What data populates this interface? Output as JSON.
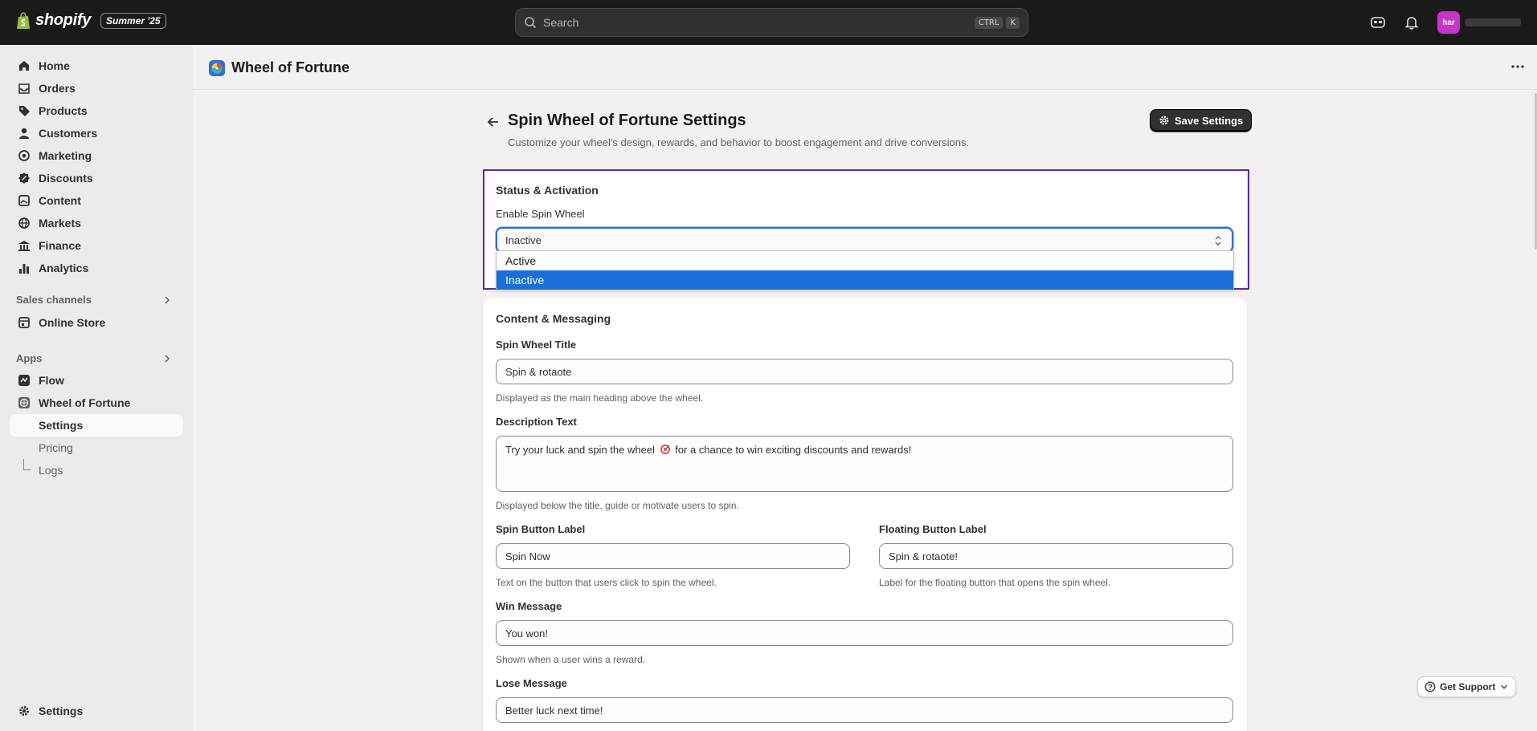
{
  "topbar": {
    "brand": "shopify",
    "edition": "Summer '25",
    "search_placeholder": "Search",
    "shortcut_ctrl": "CTRL",
    "shortcut_k": "K",
    "avatar_initials": "har"
  },
  "sidebar": {
    "items": [
      {
        "label": "Home",
        "icon": "home-icon"
      },
      {
        "label": "Orders",
        "icon": "inbox-icon"
      },
      {
        "label": "Products",
        "icon": "tag-icon"
      },
      {
        "label": "Customers",
        "icon": "person-icon"
      },
      {
        "label": "Marketing",
        "icon": "target-icon"
      },
      {
        "label": "Discounts",
        "icon": "discount-icon"
      },
      {
        "label": "Content",
        "icon": "image-icon"
      },
      {
        "label": "Markets",
        "icon": "globe-icon"
      },
      {
        "label": "Finance",
        "icon": "bank-icon"
      },
      {
        "label": "Analytics",
        "icon": "bar-chart-icon"
      }
    ],
    "sales_channels_heading": "Sales channels",
    "online_store": "Online Store",
    "apps_heading": "Apps",
    "flow": "Flow",
    "wheel_app": "Wheel of Fortune",
    "app_sub": [
      "Settings",
      "Pricing",
      "Logs"
    ],
    "settings": "Settings"
  },
  "app_header": {
    "title": "Wheel of Fortune"
  },
  "page": {
    "title": "Spin Wheel of Fortune Settings",
    "subtitle": "Customize your wheel's design, rewards, and behavior to boost engagement and drive conversions.",
    "save_label": "Save Settings"
  },
  "status_card": {
    "title": "Status & Activation",
    "enable_label": "Enable Spin Wheel",
    "selected_value": "Inactive",
    "options": [
      "Active",
      "Inactive"
    ]
  },
  "content_card": {
    "title": "Content & Messaging",
    "spin_title_label": "Spin Wheel Title",
    "spin_title_value": "Spin & rotaote",
    "spin_title_help": "Displayed as the main heading above the wheel.",
    "description_label": "Description Text",
    "description_before": "Try your luck and spin the wheel",
    "description_after": "for a chance to win exciting discounts and rewards!",
    "description_help": "Displayed below the title, guide or motivate users to spin.",
    "spin_button_label": "Spin Button Label",
    "spin_button_value": "Spin Now",
    "spin_button_help": "Text on the button that users click to spin the wheel.",
    "floating_label": "Floating Button Label",
    "floating_value": "Spin & rotaote!",
    "floating_help": "Label for the floating button that opens the spin wheel.",
    "win_label": "Win Message",
    "win_value": "You won!",
    "win_help": "Shown when a user wins a reward.",
    "lose_label": "Lose Message",
    "lose_value": "Better luck next time!"
  },
  "support": {
    "label": "Get Support"
  },
  "colors": {
    "topbar": "#1a1a1a",
    "accent_blue": "#1a6fd8",
    "focus_purple": "#5c2d91",
    "avatar": "#c536c9"
  }
}
